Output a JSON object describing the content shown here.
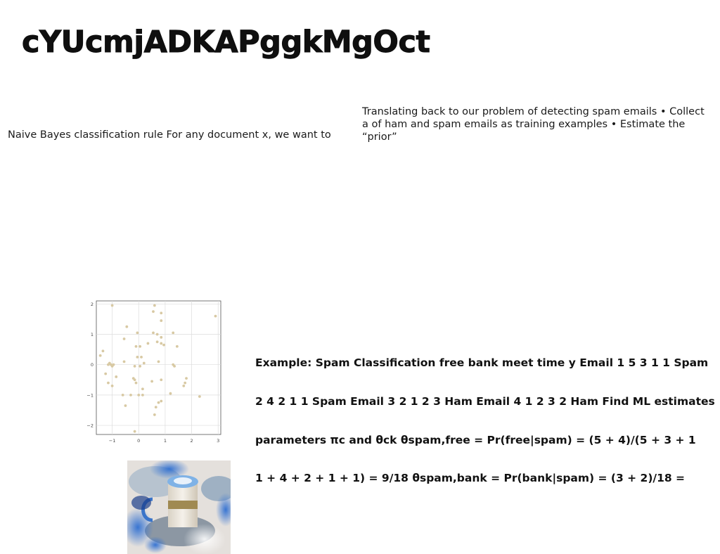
{
  "slide": {
    "title": "cYUcmjADKAPggkMgOct",
    "naive_bayes_text": "Naive Bayes classification rule For any document x, we want to",
    "translating_text": "Translating back to our problem of detecting spam emails • Collect a of ham and spam emails as training examples • Estimate the “prior”",
    "example_lines": [
      "Example: Spam Classification free bank meet time y Email 1 5 3 1 1 Spam",
      "2 4 2 1 1 Spam Email 3 2 1 2 3 Ham Email 4 1 2 3 2 Ham Find ML estimates",
      "parameters πc and θck θspam,free = Pr(free|spam) = (5 + 4)/(5 + 3 + 1",
      "1 + 4 + 2 + 1 + 1) = 9/18 θspam,bank = Pr(bank|spam) = (3 + 2)/18 ="
    ]
  },
  "chart_data": {
    "type": "scatter",
    "x_ticks": [
      "−1",
      "0",
      "1",
      "2",
      "3"
    ],
    "y_ticks": [
      "2",
      "1",
      "0",
      "−1",
      "−2"
    ],
    "xlim": [
      -1.6,
      3.1
    ],
    "ylim": [
      -2.3,
      2.1
    ],
    "grid": true,
    "point_color": "#d8c9a3",
    "points": [
      [
        -1.0,
        1.95
      ],
      [
        0.6,
        1.95
      ],
      [
        0.55,
        1.75
      ],
      [
        0.85,
        1.7
      ],
      [
        2.9,
        1.6
      ],
      [
        0.85,
        1.45
      ],
      [
        -0.45,
        1.25
      ],
      [
        0.55,
        1.05
      ],
      [
        0.7,
        1.0
      ],
      [
        -0.05,
        1.05
      ],
      [
        1.3,
        1.05
      ],
      [
        0.85,
        0.9
      ],
      [
        -0.55,
        0.85
      ],
      [
        0.35,
        0.7
      ],
      [
        0.7,
        0.75
      ],
      [
        0.85,
        0.7
      ],
      [
        0.95,
        0.65
      ],
      [
        -0.1,
        0.6
      ],
      [
        0.05,
        0.6
      ],
      [
        1.45,
        0.6
      ],
      [
        -1.35,
        0.45
      ],
      [
        -1.45,
        0.3
      ],
      [
        -0.05,
        0.25
      ],
      [
        0.1,
        0.25
      ],
      [
        -0.55,
        0.1
      ],
      [
        -1.1,
        0.05
      ],
      [
        -1.05,
        0.0
      ],
      [
        -1.15,
        0.0
      ],
      [
        -0.95,
        0.0
      ],
      [
        -1.0,
        -0.05
      ],
      [
        -0.15,
        -0.05
      ],
      [
        0.05,
        -0.05
      ],
      [
        0.2,
        0.05
      ],
      [
        0.75,
        0.1
      ],
      [
        1.3,
        0.0
      ],
      [
        1.35,
        -0.05
      ],
      [
        -1.25,
        -0.3
      ],
      [
        -0.85,
        -0.4
      ],
      [
        -0.2,
        -0.45
      ],
      [
        -0.15,
        -0.5
      ],
      [
        0.5,
        -0.55
      ],
      [
        0.85,
        -0.5
      ],
      [
        1.8,
        -0.45
      ],
      [
        -1.15,
        -0.6
      ],
      [
        -1.0,
        -0.7
      ],
      [
        -0.1,
        -0.6
      ],
      [
        0.15,
        -0.8
      ],
      [
        1.75,
        -0.6
      ],
      [
        1.7,
        -0.7
      ],
      [
        -0.6,
        -1.0
      ],
      [
        -0.3,
        -1.0
      ],
      [
        0.0,
        -1.0
      ],
      [
        0.15,
        -1.0
      ],
      [
        1.2,
        -0.95
      ],
      [
        2.3,
        -1.05
      ],
      [
        0.75,
        -1.25
      ],
      [
        0.85,
        -1.2
      ],
      [
        0.65,
        -1.4
      ],
      [
        -0.5,
        -1.35
      ],
      [
        0.6,
        -1.65
      ],
      [
        -0.15,
        -2.2
      ]
    ]
  },
  "photo": {
    "icon": "coffee-cup-photo",
    "colors": {
      "bg": "#e7e3de",
      "blue": "#2f6fd1",
      "dark_blue": "#1d3f8a",
      "cup_top": "#7fb2e6",
      "cup_body": "#f1ece3",
      "band": "#a08a52",
      "plate": "#8a9fb5"
    }
  }
}
